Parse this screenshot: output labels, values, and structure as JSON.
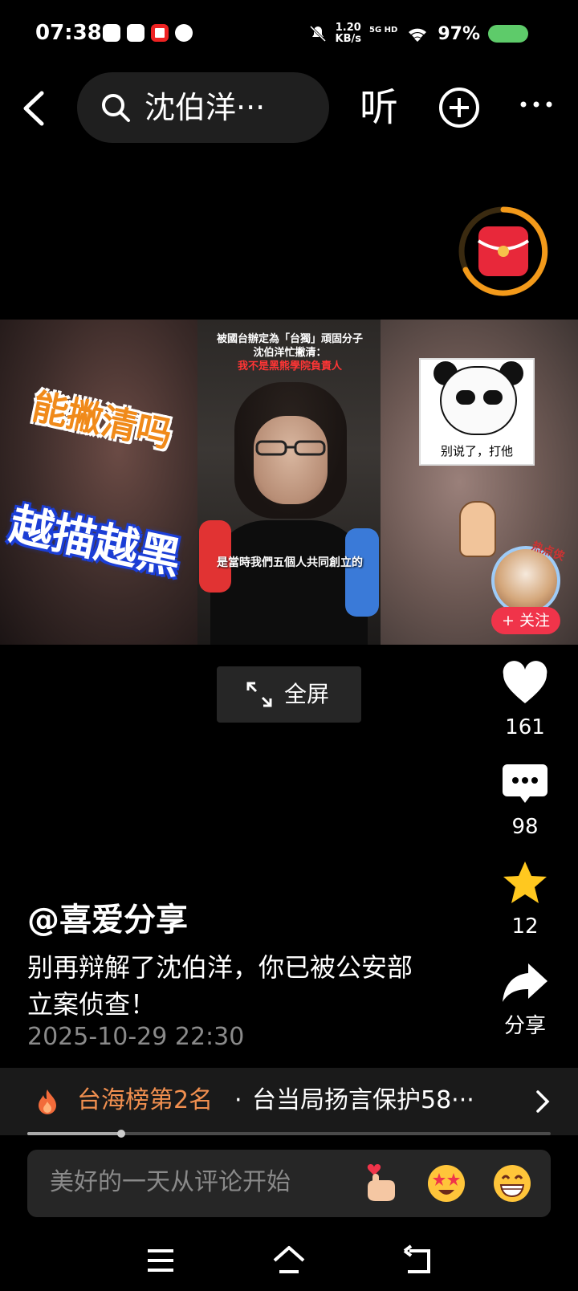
{
  "status_bar": {
    "time": "07:38",
    "net_speed_value": "1.20",
    "net_speed_unit": "KB/s",
    "network": "5G HD",
    "battery": "97%"
  },
  "top_bar": {
    "search_text": "沈伯洋···",
    "listen_label": "听"
  },
  "video": {
    "caption_orange": "能撇清吗",
    "caption_blue": "越描越黑",
    "headline_line1": "被國台辦定為「台獨」頑固分子",
    "headline_line2": "沈伯洋忙撇清：",
    "headline_line3": "我不是黑熊學院負責人",
    "subtitle": "是當時我們五個人共同創立的",
    "sticker_text": "别说了，打他",
    "avatar_tag": "热点侠"
  },
  "follow_label": "+ 关注",
  "fullscreen_label": "全屏",
  "actions": {
    "likes": "161",
    "comments": "98",
    "favorites": "12",
    "share_label": "分享"
  },
  "post": {
    "author": "@喜爱分享",
    "description": "别再辩解了沈伯洋，你已被公安部立案侦查！",
    "date": "2025-10-29 22:30"
  },
  "trending": {
    "rank_label": "台海榜第2名",
    "separator": "·",
    "headline": "台当局扬言保护58···"
  },
  "progress_fraction": 0.18,
  "comment_box": {
    "placeholder": "美好的一天从评论开始"
  },
  "colors": {
    "accent_orange": "#f08f4f",
    "follow_red": "#f0344a",
    "battery_green": "#5ecb6a"
  },
  "icons": [
    "back-icon",
    "search-icon",
    "add-circle-icon",
    "more-icon",
    "red-envelope-icon",
    "expand-icon",
    "heart-icon",
    "comment-icon",
    "star-icon",
    "share-icon",
    "fire-icon",
    "chevron-right-icon",
    "menu-icon",
    "home-icon",
    "return-icon"
  ]
}
